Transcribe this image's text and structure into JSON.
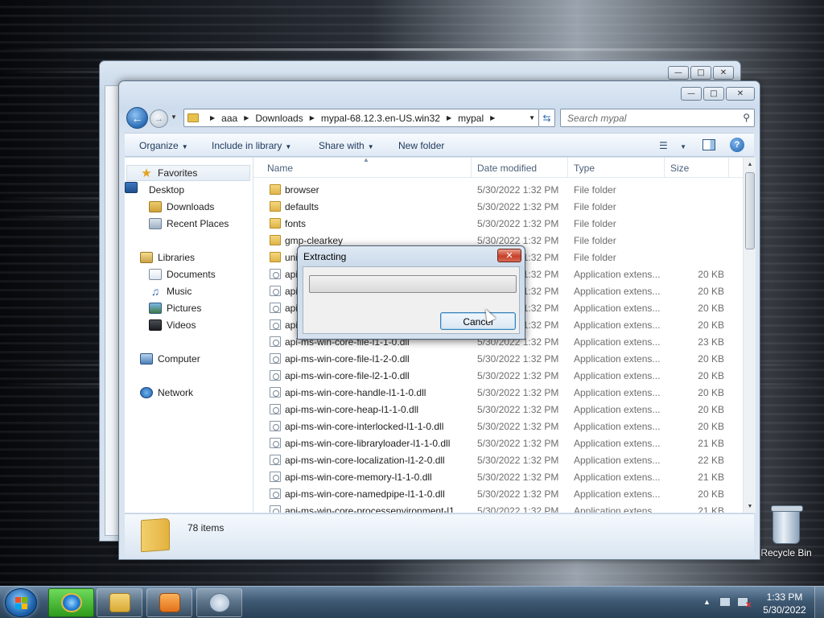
{
  "desktop": {
    "recycle_bin_label": "Recycle Bin"
  },
  "window": {
    "address": [
      "aaa",
      "Downloads",
      "mypal-68.12.3.en-US.win32",
      "mypal"
    ],
    "search_placeholder": "Search mypal",
    "toolbar": {
      "organize": "Organize",
      "include_in_library": "Include in library",
      "share_with": "Share with",
      "new_folder": "New folder"
    },
    "nav": {
      "favorites": "Favorites",
      "desktop": "Desktop",
      "downloads": "Downloads",
      "recent_places": "Recent Places",
      "libraries": "Libraries",
      "documents": "Documents",
      "music": "Music",
      "pictures": "Pictures",
      "videos": "Videos",
      "computer": "Computer",
      "network": "Network"
    },
    "columns": {
      "name": "Name",
      "date_modified": "Date modified",
      "type": "Type",
      "size": "Size"
    },
    "files": [
      {
        "name": "browser",
        "date": "5/30/2022 1:32 PM",
        "type": "File folder",
        "size": "",
        "kind": "folder"
      },
      {
        "name": "defaults",
        "date": "5/30/2022 1:32 PM",
        "type": "File folder",
        "size": "",
        "kind": "folder"
      },
      {
        "name": "fonts",
        "date": "5/30/2022 1:32 PM",
        "type": "File folder",
        "size": "",
        "kind": "folder"
      },
      {
        "name": "gmp-clearkey",
        "date": "5/30/2022 1:32 PM",
        "type": "File folder",
        "size": "",
        "kind": "folder"
      },
      {
        "name": "uni",
        "date": "5/30/2022 1:32 PM",
        "type": "File folder",
        "size": "",
        "kind": "folder"
      },
      {
        "name": "api",
        "date": "5/30/2022 1:32 PM",
        "type": "Application extens...",
        "size": "20 KB",
        "kind": "dll"
      },
      {
        "name": "api",
        "date": "5/30/2022 1:32 PM",
        "type": "Application extens...",
        "size": "20 KB",
        "kind": "dll"
      },
      {
        "name": "api",
        "date": "5/30/2022 1:32 PM",
        "type": "Application extens...",
        "size": "20 KB",
        "kind": "dll"
      },
      {
        "name": "api",
        "date": "5/30/2022 1:32 PM",
        "type": "Application extens...",
        "size": "20 KB",
        "kind": "dll"
      },
      {
        "name": "api-ms-win-core-file-l1-1-0.dll",
        "date": "5/30/2022 1:32 PM",
        "type": "Application extens...",
        "size": "23 KB",
        "kind": "dll"
      },
      {
        "name": "api-ms-win-core-file-l1-2-0.dll",
        "date": "5/30/2022 1:32 PM",
        "type": "Application extens...",
        "size": "20 KB",
        "kind": "dll"
      },
      {
        "name": "api-ms-win-core-file-l2-1-0.dll",
        "date": "5/30/2022 1:32 PM",
        "type": "Application extens...",
        "size": "20 KB",
        "kind": "dll"
      },
      {
        "name": "api-ms-win-core-handle-l1-1-0.dll",
        "date": "5/30/2022 1:32 PM",
        "type": "Application extens...",
        "size": "20 KB",
        "kind": "dll"
      },
      {
        "name": "api-ms-win-core-heap-l1-1-0.dll",
        "date": "5/30/2022 1:32 PM",
        "type": "Application extens...",
        "size": "20 KB",
        "kind": "dll"
      },
      {
        "name": "api-ms-win-core-interlocked-l1-1-0.dll",
        "date": "5/30/2022 1:32 PM",
        "type": "Application extens...",
        "size": "20 KB",
        "kind": "dll"
      },
      {
        "name": "api-ms-win-core-libraryloader-l1-1-0.dll",
        "date": "5/30/2022 1:32 PM",
        "type": "Application extens...",
        "size": "21 KB",
        "kind": "dll"
      },
      {
        "name": "api-ms-win-core-localization-l1-2-0.dll",
        "date": "5/30/2022 1:32 PM",
        "type": "Application extens...",
        "size": "22 KB",
        "kind": "dll"
      },
      {
        "name": "api-ms-win-core-memory-l1-1-0.dll",
        "date": "5/30/2022 1:32 PM",
        "type": "Application extens...",
        "size": "21 KB",
        "kind": "dll"
      },
      {
        "name": "api-ms-win-core-namedpipe-l1-1-0.dll",
        "date": "5/30/2022 1:32 PM",
        "type": "Application extens...",
        "size": "20 KB",
        "kind": "dll"
      },
      {
        "name": "api-ms-win-core-processenvironment-l1",
        "date": "5/30/2022 1:32 PM",
        "type": "Application extens...",
        "size": "21 KB",
        "kind": "dll"
      }
    ],
    "item_count": "78 items"
  },
  "dialog": {
    "title": "Extracting",
    "cancel_label": "Cancel",
    "progress_fraction": 0
  },
  "taskbar": {
    "time": "1:33 PM",
    "date": "5/30/2022"
  }
}
